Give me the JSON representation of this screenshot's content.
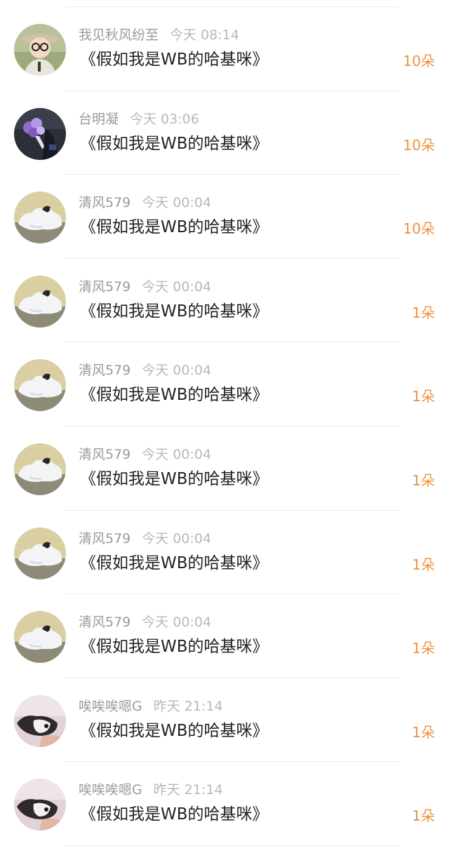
{
  "rows": [
    {
      "username": "我见秋风纷至",
      "time": "今天 08:14",
      "message": "《假如我是WB的哈基咪》",
      "gift_count": "10朵",
      "avatar_icon": "boy-glasses-avatar-icon"
    },
    {
      "username": "台明凝",
      "time": "今天 03:06",
      "message": "《假如我是WB的哈基咪》",
      "gift_count": "10朵",
      "avatar_icon": "flower-bouquet-avatar-icon"
    },
    {
      "username": "清风579",
      "time": "今天 00:04",
      "message": "《假如我是WB的哈基咪》",
      "gift_count": "10朵",
      "avatar_icon": "white-cat-avatar-icon"
    },
    {
      "username": "清风579",
      "time": "今天 00:04",
      "message": "《假如我是WB的哈基咪》",
      "gift_count": "1朵",
      "avatar_icon": "white-cat-avatar-icon"
    },
    {
      "username": "清风579",
      "time": "今天 00:04",
      "message": "《假如我是WB的哈基咪》",
      "gift_count": "1朵",
      "avatar_icon": "white-cat-avatar-icon"
    },
    {
      "username": "清风579",
      "time": "今天 00:04",
      "message": "《假如我是WB的哈基咪》",
      "gift_count": "1朵",
      "avatar_icon": "white-cat-avatar-icon"
    },
    {
      "username": "清风579",
      "time": "今天 00:04",
      "message": "《假如我是WB的哈基咪》",
      "gift_count": "1朵",
      "avatar_icon": "white-cat-avatar-icon"
    },
    {
      "username": "清风579",
      "time": "今天 00:04",
      "message": "《假如我是WB的哈基咪》",
      "gift_count": "1朵",
      "avatar_icon": "white-cat-avatar-icon"
    },
    {
      "username": "唉唉唉嗯G",
      "time": "昨天 21:14",
      "message": "《假如我是WB的哈基咪》",
      "gift_count": "1朵",
      "avatar_icon": "puppy-avatar-icon"
    },
    {
      "username": "唉唉唉嗯G",
      "time": "昨天 21:14",
      "message": "《假如我是WB的哈基咪》",
      "gift_count": "1朵",
      "avatar_icon": "puppy-avatar-icon"
    }
  ],
  "colors": {
    "gift_count": "#f0913c",
    "username": "#9a9a9a",
    "time": "#b8b8b8",
    "message": "#222222",
    "divider": "#ececec"
  }
}
